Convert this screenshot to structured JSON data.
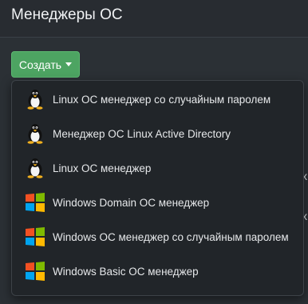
{
  "header": {
    "title": "Менеджеры ОС"
  },
  "toolbar": {
    "create_label": "Создать"
  },
  "menu": {
    "items": [
      {
        "label": "Linux ОС менеджер со случайным паролем",
        "icon": "tux-icon"
      },
      {
        "label": "Менеджер ОС Linux Active Directory",
        "icon": "tux-icon"
      },
      {
        "label": "Linux ОС менеджер",
        "icon": "tux-icon"
      },
      {
        "label": "Windows Domain ОС менеджер",
        "icon": "windows-icon"
      },
      {
        "label": "Windows ОС менеджер со случайным паролем",
        "icon": "windows-icon"
      },
      {
        "label": "Windows Basic ОС менеджер",
        "icon": "windows-icon"
      }
    ]
  },
  "colors": {
    "accent": "#4da462",
    "background": "#2b3035",
    "menu_bg": "#212529"
  }
}
